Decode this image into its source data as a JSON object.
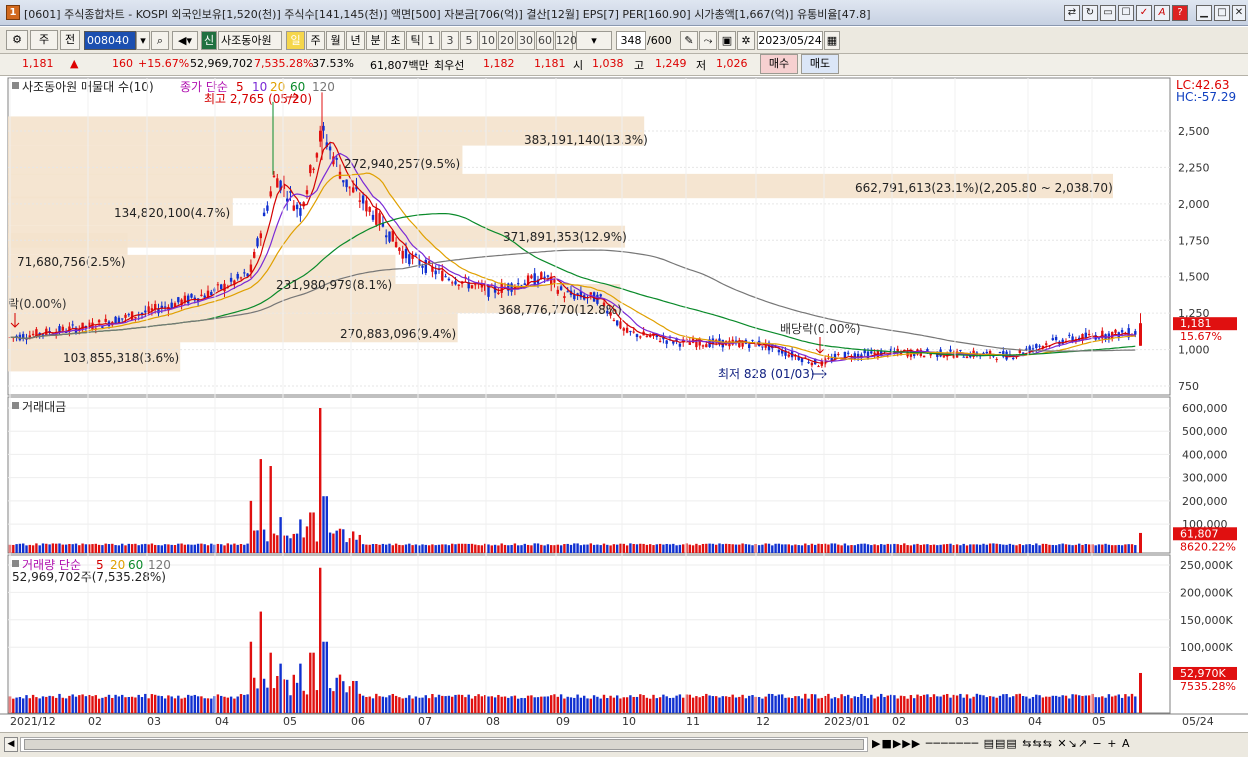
{
  "window": {
    "title": "[0601] 주식종합차트 - KOSPI 외국인보유[1,520(천)] 주식수[141,145(천)] 액면[500] 자본금[706(억)] 결산[12월] EPS[7] PER[160.90] 시가총액[1,667(억)] 유통비율[47.8]",
    "icon": "1"
  },
  "toolbar": {
    "period_select": "주",
    "all_label": "전",
    "code": "008040",
    "sin_label": "신",
    "stock_name": "사조동아원",
    "period_tabs": [
      "일",
      "주",
      "월",
      "년",
      "분",
      "초",
      "틱"
    ],
    "active_period": "일",
    "intervals": [
      "1",
      "3",
      "5",
      "10",
      "20",
      "30",
      "60",
      "120"
    ],
    "count_value": "348",
    "count_max": "/600",
    "date": "2023/05/24"
  },
  "quote": {
    "price": "1,181",
    "change": "160",
    "change_pct": "+15.67%",
    "volume": "52,969,702",
    "vol_ratio": "7,535.28%",
    "turnover": "37.53%",
    "amount": "61,807백만",
    "best_label": "최우선",
    "best_ask": "1,182",
    "best_bid": "1,181",
    "open_label": "시",
    "open": "1,038",
    "high_label": "고",
    "high": "1,249",
    "low_label": "저",
    "low": "1,026",
    "buy_label": "매수",
    "sell_label": "매도"
  },
  "price_panel": {
    "title": "사조동아원 매물대 수(10)",
    "ma_label": "종가 단순",
    "ma_periods": [
      "5",
      "10",
      "20",
      "60",
      "120"
    ],
    "ma_colors": [
      "#d40000",
      "#7a2ad6",
      "#e0a000",
      "#0a8a2a",
      "#777777"
    ],
    "high_marker": "최고 2,765 (05/20)",
    "low_marker": "최저 828 (01/03)",
    "dividend": "배당락(0.00%)",
    "dividend_left": "락(0.00%)",
    "lc": "LC:42.63",
    "hc": "HC:-57.29",
    "last_price": "1,181",
    "last_pct": "15.67%",
    "y_ticks": [
      "2,500",
      "2,250",
      "2,000",
      "1,750",
      "1,500",
      "1,250",
      "1,000",
      "750"
    ],
    "volume_profile": [
      {
        "label": "103,855,318(3.6%)",
        "lo": 850,
        "hi": 1050,
        "share": 3.6
      },
      {
        "label": "270,883,096(9.4%)",
        "lo": 1050,
        "hi": 1250,
        "share": 9.4
      },
      {
        "label": "368,776,770(12.8%)",
        "lo": 1250,
        "hi": 1450,
        "share": 12.8
      },
      {
        "label": "231,980,979(8.1%)",
        "lo": 1450,
        "hi": 1650,
        "share": 8.1
      },
      {
        "label": "71,680,756(2.5%)",
        "lo": 1650,
        "hi": 1800,
        "share": 2.5
      },
      {
        "label": "371,891,353(12.9%)",
        "lo": 1700,
        "hi": 1850,
        "share": 12.9
      },
      {
        "label": "134,820,100(4.7%)",
        "lo": 1850,
        "hi": 2050,
        "share": 4.7
      },
      {
        "label": "662,791,613(23.1%)(2,205.80 ~ 2,038.70)",
        "lo": 2038.7,
        "hi": 2205.8,
        "share": 23.1
      },
      {
        "label": "272,940,257(9.5%)",
        "lo": 2200,
        "hi": 2400,
        "share": 9.5
      },
      {
        "label": "383,191,140(13.3%)",
        "lo": 2400,
        "hi": 2600,
        "share": 13.3
      }
    ]
  },
  "amount_panel": {
    "title": "거래대금",
    "y_ticks": [
      "600,000",
      "500,000",
      "400,000",
      "300,000",
      "200,000",
      "100,000"
    ],
    "last": "61,807",
    "last_pct": "8620.22%"
  },
  "volume_panel": {
    "title": "거래량 단순",
    "ma_periods": [
      "5",
      "20",
      "60",
      "120"
    ],
    "sub": "52,969,702주(7,535.28%)",
    "y_ticks": [
      "250,000K",
      "200,000K",
      "150,000K",
      "100,000K"
    ],
    "last": "52,970K",
    "last_pct": "7535.28%"
  },
  "x_axis": [
    "2021/12",
    "02",
    "03",
    "04",
    "05",
    "06",
    "07",
    "08",
    "09",
    "10",
    "11",
    "12",
    "2023/01",
    "02",
    "03",
    "04",
    "05",
    "05/24"
  ],
  "colors": {
    "up": "#e01010",
    "down": "#1030d0",
    "profile": "#f4e2cc",
    "marker": "#d40000",
    "low_marker": "#102080"
  }
}
